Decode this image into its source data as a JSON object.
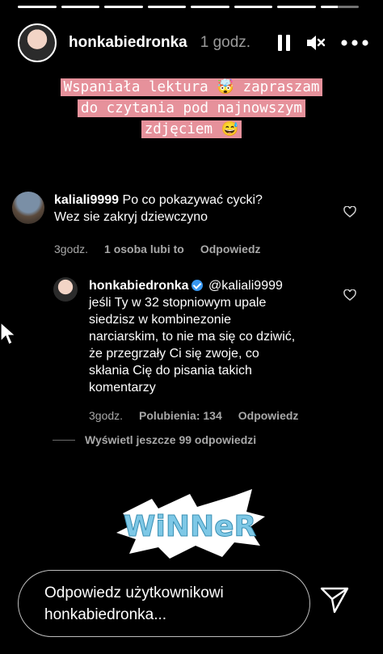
{
  "story": {
    "progress_segments": 8,
    "progress_filled": 7,
    "progress_current_fraction": 0.45,
    "username": "honkabiedronka",
    "time_ago": "1 godz.",
    "caption_lines": [
      "Wspaniała lektura 🤯 zapraszam",
      "do czytania pod najnowszym",
      "zdjęciem 😅"
    ]
  },
  "comment": {
    "username": "kaliali9999",
    "text_lines": [
      "Po co pokazywać cycki?",
      "Wez sie zakryj dziewczyno"
    ],
    "time": "3godz.",
    "likes": "1 osoba lubi to",
    "reply_label": "Odpowiedz"
  },
  "reply": {
    "username": "honkabiedronka",
    "mention": "@kaliali9999",
    "text_lines": [
      "jeśli Ty w 32 stopniowym upale",
      "siedzisz w kombinezonie",
      "narciarskim, to nie ma się co dziwić,",
      "że przegrzały Ci się zwoje, co",
      "skłania Cię do pisania takich",
      "komentarzy"
    ],
    "time": "3godz.",
    "likes": "Polubienia: 134",
    "reply_label": "Odpowiedz"
  },
  "more_replies": "Wyświetl jeszcze 99 odpowiedzi",
  "sticker_text": "WiNNeR",
  "reply_bar": {
    "placeholder_lines": [
      "Odpowiedz użytkownikowi",
      "honkabiedronka..."
    ]
  },
  "colors": {
    "caption_highlight": "#e6919b",
    "verified": "#3897f0",
    "meta_text": "#a8a8a8"
  },
  "icons": [
    "pause-icon",
    "mute-icon",
    "more-icon",
    "heart-icon",
    "verified-icon",
    "send-icon",
    "cursor-icon"
  ]
}
